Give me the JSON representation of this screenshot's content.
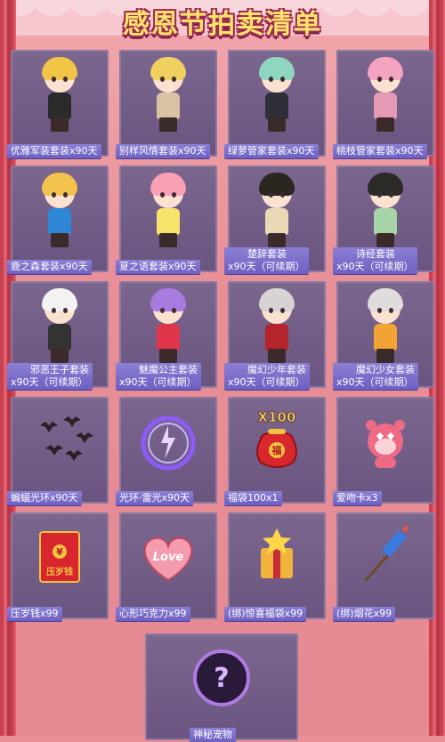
{
  "title": "感恩节拍卖清单",
  "items": [
    {
      "name": "优雅军装套装",
      "duration": "x90天",
      "hair": "#f2c447",
      "outfit": "#2a2a2a"
    },
    {
      "name": "别样风情套装",
      "duration": "x90天",
      "hair": "#f0d060",
      "outfit": "#d8c3a5"
    },
    {
      "name": "绿萝管家套装",
      "duration": "x90天",
      "hair": "#8fd6c1",
      "outfit": "#2f2f3a"
    },
    {
      "name": "桃枝管家套装",
      "duration": "x90天",
      "hair": "#f4a3c0",
      "outfit": "#e59ab6"
    },
    {
      "name": "鹿之森套装",
      "duration": "x90天",
      "hair": "#f4c34e",
      "outfit": "#2e86d4"
    },
    {
      "name": "夏之语套装",
      "duration": "x90天",
      "hair": "#f7a0b6",
      "outfit": "#f7e36a"
    },
    {
      "name": "楚辞套装",
      "duration": "x90天（可续期）",
      "hair": "#2b2620",
      "outfit": "#e9d9b7"
    },
    {
      "name": "诗经套装",
      "duration": "x90天（可续期）",
      "hair": "#2b2a26",
      "outfit": "#a7d4a8"
    },
    {
      "name": "邪恶王子套装",
      "duration": "x90天（可续期）",
      "hair": "#f2f2f2",
      "outfit": "#333333"
    },
    {
      "name": "魅魔公主套装",
      "duration": "x90天（可续期）",
      "hair": "#a77be0",
      "outfit": "#e0344b"
    },
    {
      "name": "魔幻少年套装",
      "duration": "x90天（可续期）",
      "hair": "#d8d2d2",
      "outfit": "#b4242a"
    },
    {
      "name": "魔幻少女套装",
      "duration": "x90天（可续期）",
      "hair": "#e0dcdc",
      "outfit": "#f1a434"
    },
    {
      "name": "蝙蝠光环",
      "duration": "x90天",
      "icon": "bat-halo-icon"
    },
    {
      "name": "光环·雷光",
      "duration": "x90天",
      "icon": "thunder-halo-icon"
    },
    {
      "name": "福袋100",
      "duration": "x1",
      "icon": "lucky-bag-icon",
      "badge": "X100",
      "bag_text": "福"
    },
    {
      "name": "爱吻卡",
      "duration": "x3",
      "icon": "kiss-card-icon"
    },
    {
      "name": "压岁钱",
      "duration": "x99",
      "icon": "red-envelope-icon",
      "env_text": "压岁钱"
    },
    {
      "name": "心形巧克力",
      "duration": "x99",
      "icon": "heart-chocolate-icon",
      "choc_text": "Love"
    },
    {
      "name": "(绑)惊喜福袋",
      "duration": "x99",
      "icon": "surprise-bag-icon"
    },
    {
      "name": "(绑)烟花",
      "duration": "x99",
      "icon": "firework-rocket-icon"
    },
    {
      "name": "神秘宠物",
      "duration": "",
      "icon": "mystery-pet-icon"
    }
  ]
}
